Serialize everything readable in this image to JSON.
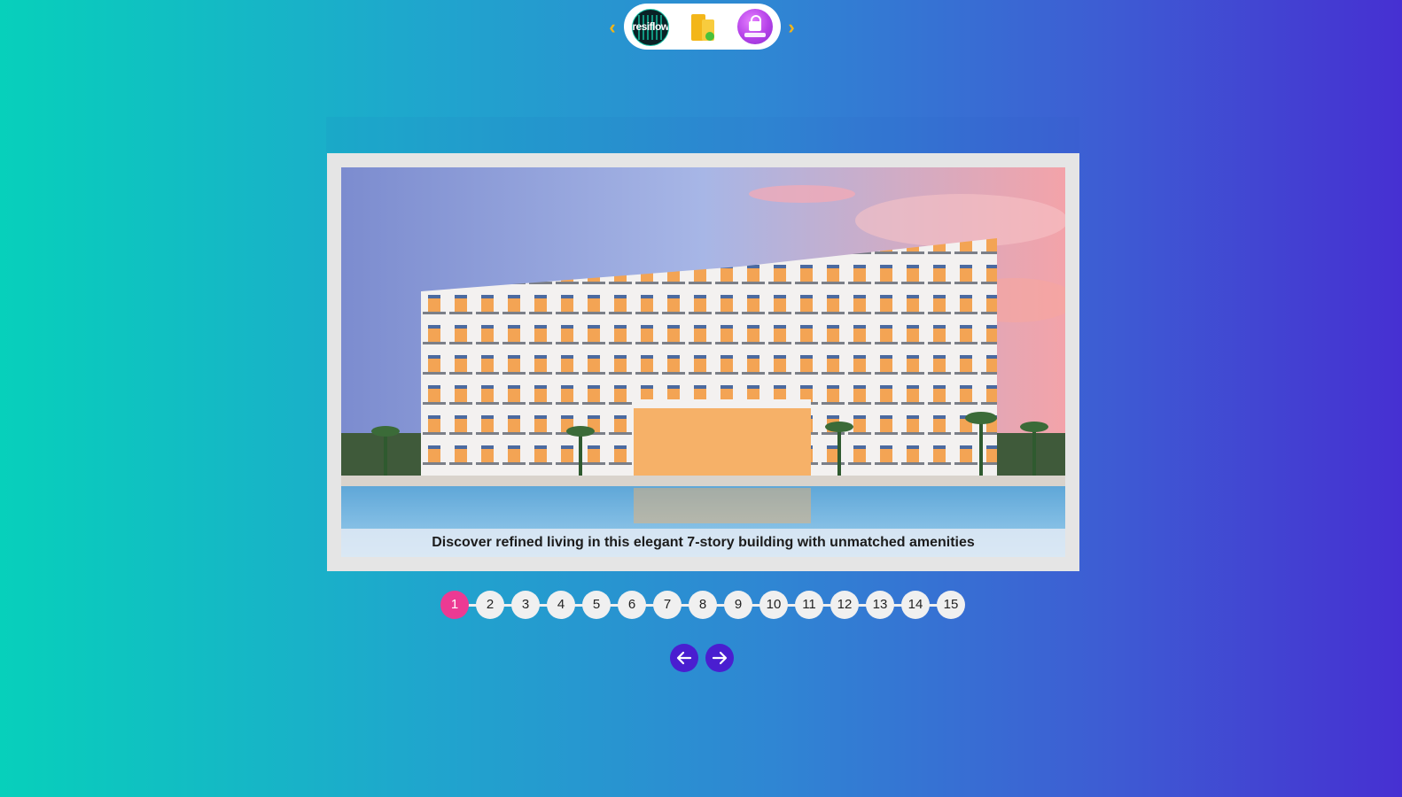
{
  "topnav": {
    "prev_icon": "chevron-left-icon",
    "next_icon": "chevron-right-icon",
    "apps": [
      {
        "name": "resiflow",
        "label": "resiflow"
      },
      {
        "name": "buildings",
        "icon": "building-icon"
      },
      {
        "name": "password",
        "icon": "lock-icon"
      }
    ],
    "accent": "#f5b517"
  },
  "gallery": {
    "caption": "Discover refined living in this elegant 7-story building with unmatched amenities",
    "image": "apartment-building-pool-sunset"
  },
  "pagination": {
    "pages": [
      "1",
      "2",
      "3",
      "4",
      "5",
      "6",
      "7",
      "8",
      "9",
      "10",
      "11",
      "12",
      "13",
      "14",
      "15"
    ],
    "active_page": "1",
    "active_color": "#ec3a93"
  },
  "controls": {
    "prev_icon": "arrow-left-icon",
    "next_icon": "arrow-right-icon",
    "button_color": "#4a1ed0"
  }
}
